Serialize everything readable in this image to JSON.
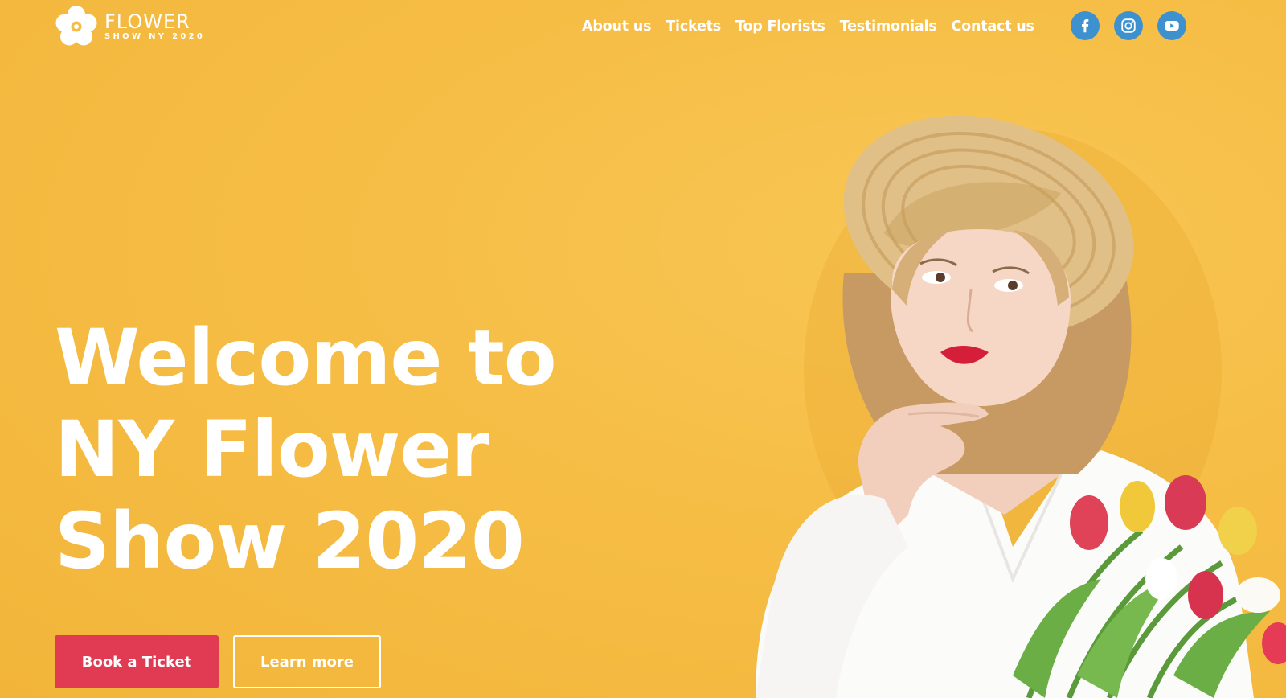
{
  "logo": {
    "title": "FLOWER",
    "subtitle": "SHOW NY 2020",
    "icon": "flower-icon"
  },
  "nav": {
    "items": [
      {
        "label": "About us"
      },
      {
        "label": "Tickets"
      },
      {
        "label": "Top Florists"
      },
      {
        "label": "Testimonials"
      },
      {
        "label": "Contact us"
      }
    ]
  },
  "socials": [
    {
      "icon": "facebook-icon"
    },
    {
      "icon": "instagram-icon"
    },
    {
      "icon": "youtube-icon"
    }
  ],
  "hero": {
    "headline_lines": [
      "Welcome to",
      "NY Flower",
      "Show 2020"
    ],
    "primary_button": "Book a Ticket",
    "secondary_button": "Learn more",
    "image": "woman-with-straw-hat-and-tulips-photo"
  },
  "colors": {
    "background": "#f6bd45",
    "primary": "#e13b53",
    "social": "#3d91cf",
    "text": "#ffffff"
  }
}
